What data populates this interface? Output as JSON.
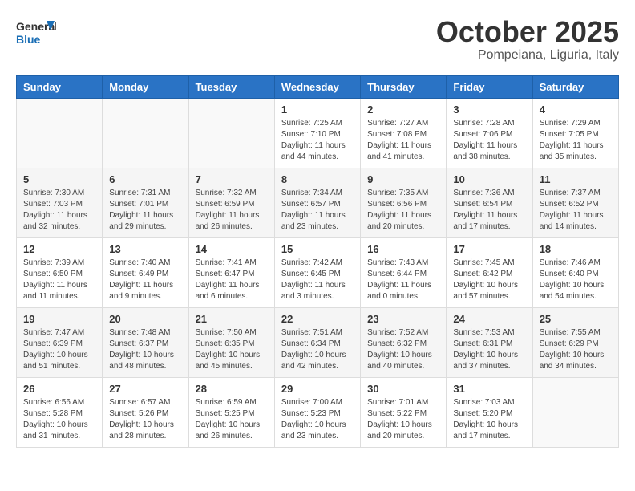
{
  "header": {
    "logo_general": "General",
    "logo_blue": "Blue",
    "month": "October 2025",
    "location": "Pompeiana, Liguria, Italy"
  },
  "weekdays": [
    "Sunday",
    "Monday",
    "Tuesday",
    "Wednesday",
    "Thursday",
    "Friday",
    "Saturday"
  ],
  "weeks": [
    [
      {
        "day": "",
        "info": ""
      },
      {
        "day": "",
        "info": ""
      },
      {
        "day": "",
        "info": ""
      },
      {
        "day": "1",
        "info": "Sunrise: 7:25 AM\nSunset: 7:10 PM\nDaylight: 11 hours and 44 minutes."
      },
      {
        "day": "2",
        "info": "Sunrise: 7:27 AM\nSunset: 7:08 PM\nDaylight: 11 hours and 41 minutes."
      },
      {
        "day": "3",
        "info": "Sunrise: 7:28 AM\nSunset: 7:06 PM\nDaylight: 11 hours and 38 minutes."
      },
      {
        "day": "4",
        "info": "Sunrise: 7:29 AM\nSunset: 7:05 PM\nDaylight: 11 hours and 35 minutes."
      }
    ],
    [
      {
        "day": "5",
        "info": "Sunrise: 7:30 AM\nSunset: 7:03 PM\nDaylight: 11 hours and 32 minutes."
      },
      {
        "day": "6",
        "info": "Sunrise: 7:31 AM\nSunset: 7:01 PM\nDaylight: 11 hours and 29 minutes."
      },
      {
        "day": "7",
        "info": "Sunrise: 7:32 AM\nSunset: 6:59 PM\nDaylight: 11 hours and 26 minutes."
      },
      {
        "day": "8",
        "info": "Sunrise: 7:34 AM\nSunset: 6:57 PM\nDaylight: 11 hours and 23 minutes."
      },
      {
        "day": "9",
        "info": "Sunrise: 7:35 AM\nSunset: 6:56 PM\nDaylight: 11 hours and 20 minutes."
      },
      {
        "day": "10",
        "info": "Sunrise: 7:36 AM\nSunset: 6:54 PM\nDaylight: 11 hours and 17 minutes."
      },
      {
        "day": "11",
        "info": "Sunrise: 7:37 AM\nSunset: 6:52 PM\nDaylight: 11 hours and 14 minutes."
      }
    ],
    [
      {
        "day": "12",
        "info": "Sunrise: 7:39 AM\nSunset: 6:50 PM\nDaylight: 11 hours and 11 minutes."
      },
      {
        "day": "13",
        "info": "Sunrise: 7:40 AM\nSunset: 6:49 PM\nDaylight: 11 hours and 9 minutes."
      },
      {
        "day": "14",
        "info": "Sunrise: 7:41 AM\nSunset: 6:47 PM\nDaylight: 11 hours and 6 minutes."
      },
      {
        "day": "15",
        "info": "Sunrise: 7:42 AM\nSunset: 6:45 PM\nDaylight: 11 hours and 3 minutes."
      },
      {
        "day": "16",
        "info": "Sunrise: 7:43 AM\nSunset: 6:44 PM\nDaylight: 11 hours and 0 minutes."
      },
      {
        "day": "17",
        "info": "Sunrise: 7:45 AM\nSunset: 6:42 PM\nDaylight: 10 hours and 57 minutes."
      },
      {
        "day": "18",
        "info": "Sunrise: 7:46 AM\nSunset: 6:40 PM\nDaylight: 10 hours and 54 minutes."
      }
    ],
    [
      {
        "day": "19",
        "info": "Sunrise: 7:47 AM\nSunset: 6:39 PM\nDaylight: 10 hours and 51 minutes."
      },
      {
        "day": "20",
        "info": "Sunrise: 7:48 AM\nSunset: 6:37 PM\nDaylight: 10 hours and 48 minutes."
      },
      {
        "day": "21",
        "info": "Sunrise: 7:50 AM\nSunset: 6:35 PM\nDaylight: 10 hours and 45 minutes."
      },
      {
        "day": "22",
        "info": "Sunrise: 7:51 AM\nSunset: 6:34 PM\nDaylight: 10 hours and 42 minutes."
      },
      {
        "day": "23",
        "info": "Sunrise: 7:52 AM\nSunset: 6:32 PM\nDaylight: 10 hours and 40 minutes."
      },
      {
        "day": "24",
        "info": "Sunrise: 7:53 AM\nSunset: 6:31 PM\nDaylight: 10 hours and 37 minutes."
      },
      {
        "day": "25",
        "info": "Sunrise: 7:55 AM\nSunset: 6:29 PM\nDaylight: 10 hours and 34 minutes."
      }
    ],
    [
      {
        "day": "26",
        "info": "Sunrise: 6:56 AM\nSunset: 5:28 PM\nDaylight: 10 hours and 31 minutes."
      },
      {
        "day": "27",
        "info": "Sunrise: 6:57 AM\nSunset: 5:26 PM\nDaylight: 10 hours and 28 minutes."
      },
      {
        "day": "28",
        "info": "Sunrise: 6:59 AM\nSunset: 5:25 PM\nDaylight: 10 hours and 26 minutes."
      },
      {
        "day": "29",
        "info": "Sunrise: 7:00 AM\nSunset: 5:23 PM\nDaylight: 10 hours and 23 minutes."
      },
      {
        "day": "30",
        "info": "Sunrise: 7:01 AM\nSunset: 5:22 PM\nDaylight: 10 hours and 20 minutes."
      },
      {
        "day": "31",
        "info": "Sunrise: 7:03 AM\nSunset: 5:20 PM\nDaylight: 10 hours and 17 minutes."
      },
      {
        "day": "",
        "info": ""
      }
    ]
  ]
}
